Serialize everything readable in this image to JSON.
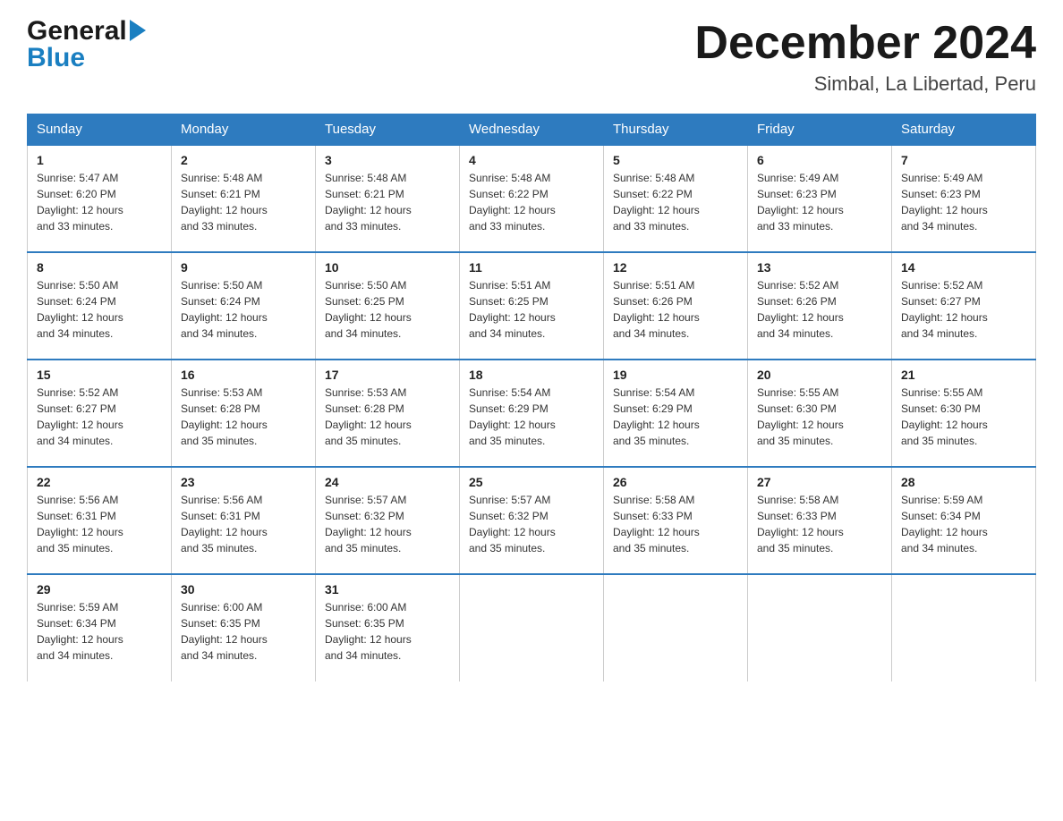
{
  "header": {
    "logo_general": "General",
    "logo_blue": "Blue",
    "month_title": "December 2024",
    "location": "Simbal, La Libertad, Peru"
  },
  "days_of_week": [
    "Sunday",
    "Monday",
    "Tuesday",
    "Wednesday",
    "Thursday",
    "Friday",
    "Saturday"
  ],
  "weeks": [
    [
      {
        "day": "1",
        "sunrise": "5:47 AM",
        "sunset": "6:20 PM",
        "daylight": "12 hours and 33 minutes."
      },
      {
        "day": "2",
        "sunrise": "5:48 AM",
        "sunset": "6:21 PM",
        "daylight": "12 hours and 33 minutes."
      },
      {
        "day": "3",
        "sunrise": "5:48 AM",
        "sunset": "6:21 PM",
        "daylight": "12 hours and 33 minutes."
      },
      {
        "day": "4",
        "sunrise": "5:48 AM",
        "sunset": "6:22 PM",
        "daylight": "12 hours and 33 minutes."
      },
      {
        "day": "5",
        "sunrise": "5:48 AM",
        "sunset": "6:22 PM",
        "daylight": "12 hours and 33 minutes."
      },
      {
        "day": "6",
        "sunrise": "5:49 AM",
        "sunset": "6:23 PM",
        "daylight": "12 hours and 33 minutes."
      },
      {
        "day": "7",
        "sunrise": "5:49 AM",
        "sunset": "6:23 PM",
        "daylight": "12 hours and 34 minutes."
      }
    ],
    [
      {
        "day": "8",
        "sunrise": "5:50 AM",
        "sunset": "6:24 PM",
        "daylight": "12 hours and 34 minutes."
      },
      {
        "day": "9",
        "sunrise": "5:50 AM",
        "sunset": "6:24 PM",
        "daylight": "12 hours and 34 minutes."
      },
      {
        "day": "10",
        "sunrise": "5:50 AM",
        "sunset": "6:25 PM",
        "daylight": "12 hours and 34 minutes."
      },
      {
        "day": "11",
        "sunrise": "5:51 AM",
        "sunset": "6:25 PM",
        "daylight": "12 hours and 34 minutes."
      },
      {
        "day": "12",
        "sunrise": "5:51 AM",
        "sunset": "6:26 PM",
        "daylight": "12 hours and 34 minutes."
      },
      {
        "day": "13",
        "sunrise": "5:52 AM",
        "sunset": "6:26 PM",
        "daylight": "12 hours and 34 minutes."
      },
      {
        "day": "14",
        "sunrise": "5:52 AM",
        "sunset": "6:27 PM",
        "daylight": "12 hours and 34 minutes."
      }
    ],
    [
      {
        "day": "15",
        "sunrise": "5:52 AM",
        "sunset": "6:27 PM",
        "daylight": "12 hours and 34 minutes."
      },
      {
        "day": "16",
        "sunrise": "5:53 AM",
        "sunset": "6:28 PM",
        "daylight": "12 hours and 35 minutes."
      },
      {
        "day": "17",
        "sunrise": "5:53 AM",
        "sunset": "6:28 PM",
        "daylight": "12 hours and 35 minutes."
      },
      {
        "day": "18",
        "sunrise": "5:54 AM",
        "sunset": "6:29 PM",
        "daylight": "12 hours and 35 minutes."
      },
      {
        "day": "19",
        "sunrise": "5:54 AM",
        "sunset": "6:29 PM",
        "daylight": "12 hours and 35 minutes."
      },
      {
        "day": "20",
        "sunrise": "5:55 AM",
        "sunset": "6:30 PM",
        "daylight": "12 hours and 35 minutes."
      },
      {
        "day": "21",
        "sunrise": "5:55 AM",
        "sunset": "6:30 PM",
        "daylight": "12 hours and 35 minutes."
      }
    ],
    [
      {
        "day": "22",
        "sunrise": "5:56 AM",
        "sunset": "6:31 PM",
        "daylight": "12 hours and 35 minutes."
      },
      {
        "day": "23",
        "sunrise": "5:56 AM",
        "sunset": "6:31 PM",
        "daylight": "12 hours and 35 minutes."
      },
      {
        "day": "24",
        "sunrise": "5:57 AM",
        "sunset": "6:32 PM",
        "daylight": "12 hours and 35 minutes."
      },
      {
        "day": "25",
        "sunrise": "5:57 AM",
        "sunset": "6:32 PM",
        "daylight": "12 hours and 35 minutes."
      },
      {
        "day": "26",
        "sunrise": "5:58 AM",
        "sunset": "6:33 PM",
        "daylight": "12 hours and 35 minutes."
      },
      {
        "day": "27",
        "sunrise": "5:58 AM",
        "sunset": "6:33 PM",
        "daylight": "12 hours and 35 minutes."
      },
      {
        "day": "28",
        "sunrise": "5:59 AM",
        "sunset": "6:34 PM",
        "daylight": "12 hours and 34 minutes."
      }
    ],
    [
      {
        "day": "29",
        "sunrise": "5:59 AM",
        "sunset": "6:34 PM",
        "daylight": "12 hours and 34 minutes."
      },
      {
        "day": "30",
        "sunrise": "6:00 AM",
        "sunset": "6:35 PM",
        "daylight": "12 hours and 34 minutes."
      },
      {
        "day": "31",
        "sunrise": "6:00 AM",
        "sunset": "6:35 PM",
        "daylight": "12 hours and 34 minutes."
      },
      null,
      null,
      null,
      null
    ]
  ],
  "labels": {
    "sunrise": "Sunrise:",
    "sunset": "Sunset:",
    "daylight": "Daylight: 12 hours"
  }
}
